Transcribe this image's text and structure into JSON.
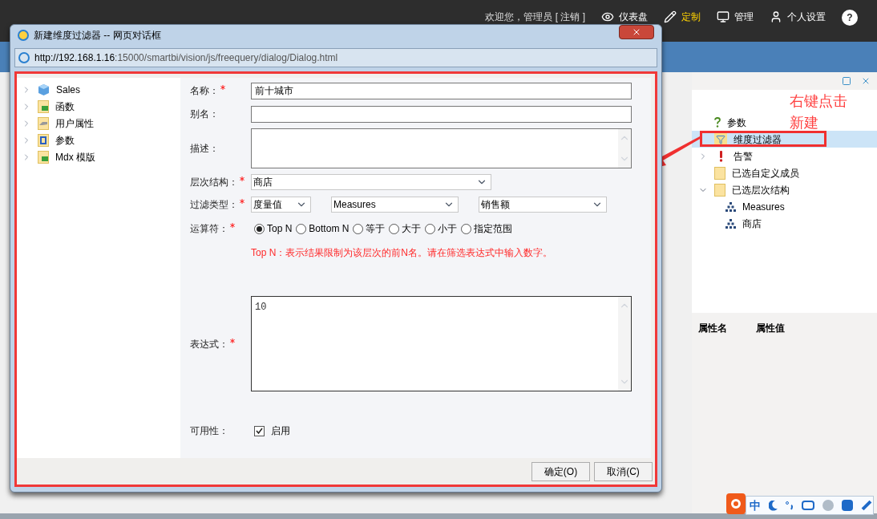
{
  "top_bar": {
    "welcome": "欢迎您，管理员 [ 注销 ]",
    "nav": [
      {
        "label": "仪表盘",
        "kind": "eye",
        "selected": false
      },
      {
        "label": "定制",
        "kind": "pencil",
        "selected": true
      },
      {
        "label": "管理",
        "kind": "monitor",
        "selected": false
      },
      {
        "label": "个人设置",
        "kind": "user",
        "selected": false
      }
    ],
    "help": "?"
  },
  "right_panel": {
    "tree": [
      {
        "label": "参数",
        "kind": "question",
        "selected": false
      },
      {
        "label": "维度过滤器",
        "kind": "filter",
        "selected": true
      },
      {
        "label": "告警",
        "kind": "alert",
        "expanded": false,
        "selected": false
      },
      {
        "label": "已选自定义成员",
        "kind": "folder",
        "selected": false
      },
      {
        "label": "已选层次结构",
        "kind": "folder",
        "expanded": true,
        "selected": false,
        "children": [
          {
            "label": "Measures",
            "kind": "hierarchy",
            "selected": false
          },
          {
            "label": "商店",
            "kind": "hierarchy",
            "selected": false
          }
        ]
      }
    ],
    "columns": [
      "属性名",
      "属性值"
    ]
  },
  "ime": {
    "mode": "中"
  },
  "annotation": {
    "lines": [
      "右键点击",
      "新建"
    ]
  },
  "dialog": {
    "title": "新建维度过滤器 -- 网页对话框",
    "url_host": "http://192.168.1.16",
    "url_rest": ":15000/smartbi/vision/js/freequery/dialog/Dialog.html",
    "tree": [
      {
        "label": "Sales",
        "kind": "cube"
      },
      {
        "label": "函数",
        "kind": "fx"
      },
      {
        "label": "用户属性",
        "kind": "userprop"
      },
      {
        "label": "参数",
        "kind": "param"
      },
      {
        "label": "Mdx 模版",
        "kind": "fx"
      }
    ],
    "form": {
      "name": {
        "label": "名称：",
        "required": true,
        "value": "前十城市"
      },
      "alias": {
        "label": "别名：",
        "required": false
      },
      "description": {
        "label": "描述：",
        "required": false
      },
      "hierarchy": {
        "label": "层次结构：",
        "required": true,
        "value": "商店"
      },
      "filter_type": {
        "label": "过滤类型：",
        "required": true,
        "selects": [
          "度量值",
          "Measures",
          "销售额"
        ]
      },
      "operator": {
        "label": "运算符：",
        "required": true,
        "options": [
          {
            "label": "Top N",
            "selected": true
          },
          {
            "label": "Bottom N",
            "selected": false
          },
          {
            "label": "等于",
            "selected": false
          },
          {
            "label": "大于",
            "selected": false
          },
          {
            "label": "小于",
            "selected": false
          },
          {
            "label": "指定范围",
            "selected": false
          }
        ]
      },
      "hint": "Top N：表示结果限制为该层次的前N名。请在筛选表达式中输入数字。",
      "expression": {
        "label": "表达式：",
        "required": true,
        "value": "10"
      },
      "availability": {
        "label": "可用性：",
        "required": false,
        "checkbox": "启用",
        "checked": true
      }
    },
    "buttons": [
      "确定(O)",
      "取消(C)"
    ]
  }
}
